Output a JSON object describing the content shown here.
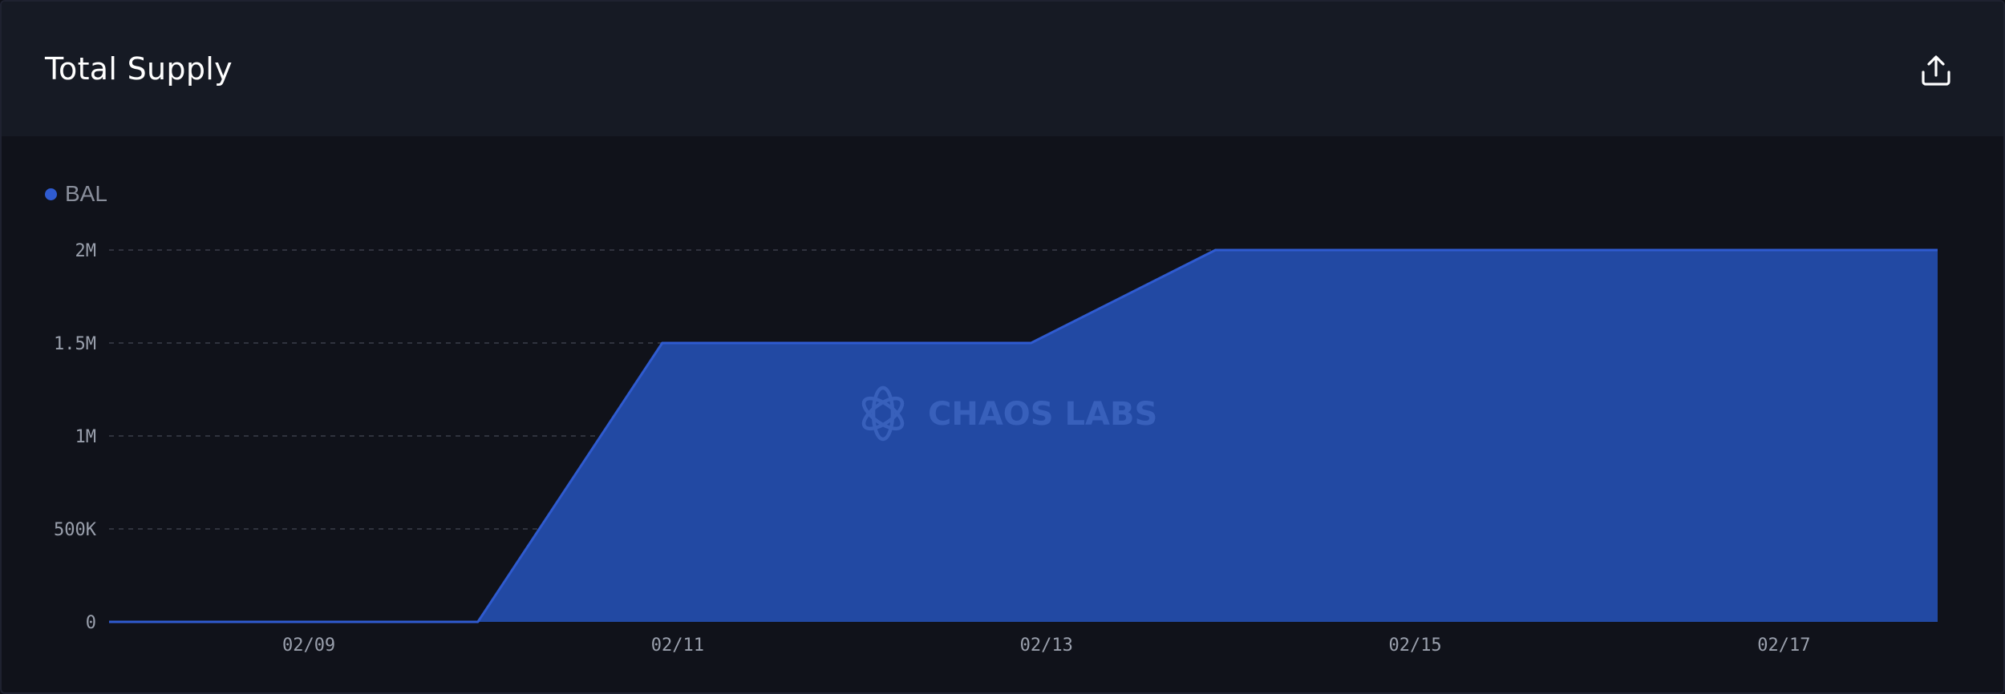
{
  "header": {
    "title": "Total Supply",
    "export_icon": "upload-icon"
  },
  "watermark": {
    "text": "CHAOS LABS",
    "icon": "atom-logo-icon"
  },
  "colors": {
    "series": "#2f5bd0",
    "area_fill": "#2249a3",
    "grid": "#3a3e4a",
    "background": "#10121a",
    "header_bg": "#161a24"
  },
  "chart_data": {
    "type": "area",
    "title": "Total Supply",
    "legend_position": "top-left",
    "grid": true,
    "x_ticks": [
      "02/09",
      "02/11",
      "02/13",
      "02/15",
      "02/17"
    ],
    "y_ticks": [
      "0",
      "500K",
      "1M",
      "1.5M",
      "2M"
    ],
    "ylim": [
      0,
      2000000
    ],
    "series": [
      {
        "name": "BAL",
        "x": [
          "02/07 22:00",
          "02/09 22:00",
          "02/10 22:00",
          "02/12 22:00",
          "02/13 22:00",
          "02/17 20:00"
        ],
        "y": [
          0,
          0,
          1500000,
          1500000,
          2000000,
          2000000
        ]
      }
    ]
  }
}
